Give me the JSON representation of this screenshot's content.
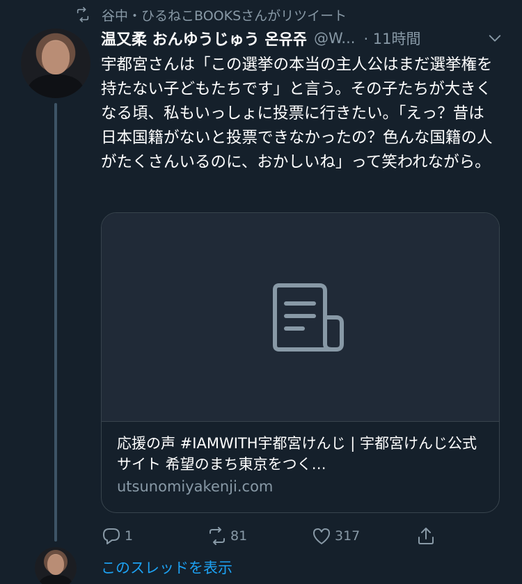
{
  "retweet_banner": {
    "text": "谷中・ひるねこBOOKSさんがリツイート"
  },
  "tweet": {
    "author_name": "温又柔 おんゆうじゅう 온유쥬",
    "handle": "@W...",
    "time": "· 11時間",
    "text": "宇都宮さんは「この選挙の本当の主人公はまだ選挙権を持たない子どもたちです」と言う。その子たちが大きくなる頃、私もいっしょに投票に行きたい。「えっ？昔は日本国籍がないと投票できなかったの？色んな国籍の人がたくさんいるのに、おかしいね」って笑われながら。"
  },
  "card": {
    "title": "応援の声 #IAMWITH宇都宮けんじ | 宇都宮けんじ公式サイト 希望のまち東京をつく…",
    "url": "utsunomiyakenji.com",
    "image_icon": "document-icon"
  },
  "actions": {
    "reply_count": "1",
    "retweet_count": "81",
    "like_count": "317"
  },
  "show_thread": "このスレッドを表示",
  "colors": {
    "background": "#15202b",
    "secondary_text": "#8899a6",
    "link": "#1da1f2",
    "border": "#38444d"
  }
}
